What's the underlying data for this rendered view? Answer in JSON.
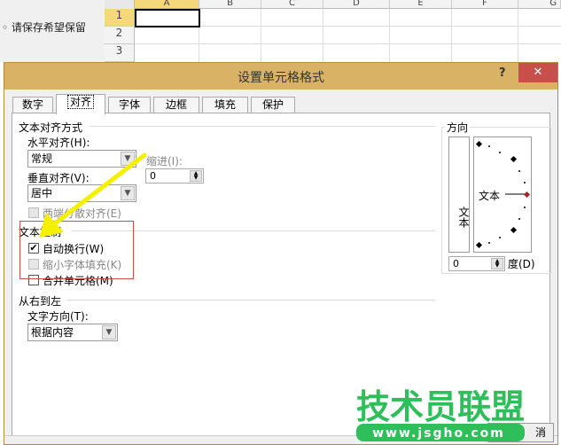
{
  "sheet": {
    "left_text": "◦ 请保存希望保留",
    "columns": [
      "A",
      "B",
      "C",
      "D",
      "E",
      "F",
      "G"
    ],
    "rows": [
      "1",
      "2",
      "3"
    ]
  },
  "dialog": {
    "title": "设置单元格格式",
    "help": "?",
    "close": "✕",
    "tabs": [
      {
        "label": "数字"
      },
      {
        "label": "对齐",
        "active": true
      },
      {
        "label": "字体"
      },
      {
        "label": "边框"
      },
      {
        "label": "填充"
      },
      {
        "label": "保护"
      }
    ],
    "alignment": {
      "section": "文本对齐方式",
      "horizontal_label": "水平对齐(H):",
      "horizontal_value": "常规",
      "indent_label": "缩进(I):",
      "indent_value": "0",
      "vertical_label": "垂直对齐(V):",
      "vertical_value": "居中",
      "justify_distributed": "两端分散对齐(E)"
    },
    "text_control": {
      "section": "文本控制",
      "wrap_text": {
        "label": "自动换行(W)",
        "checked": true
      },
      "shrink_to_fit": {
        "label": "缩小字体填充(K)",
        "checked": false,
        "disabled": true
      },
      "merge_cells": {
        "label": "合并单元格(M)",
        "checked": false
      }
    },
    "rtl": {
      "section": "从右到左",
      "direction_label": "文字方向(T):",
      "direction_value": "根据内容"
    },
    "orientation": {
      "section": "方向",
      "vertical_text": "文本",
      "dial_text": "文本",
      "degrees_value": "0",
      "degrees_label": "度(D)"
    },
    "cancel_partial": "消"
  },
  "watermark": {
    "name": "技术员联盟",
    "url": "www.jsgho.com"
  },
  "colors": {
    "titlebar": "#d9b266",
    "close": "#c7504b",
    "highlight_box": "#d04a4a",
    "arrow": "#f5f000",
    "watermark": "#2fbf5a"
  }
}
